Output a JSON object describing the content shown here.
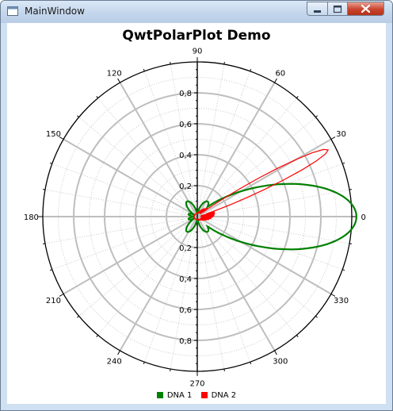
{
  "window": {
    "title": "MainWindow",
    "min_label": "–",
    "max_label": "□",
    "close_label": "✕"
  },
  "chart_data": {
    "type": "polar",
    "title": "QwtPolarPlot Demo",
    "angle_ticks": [
      "0",
      "30",
      "60",
      "90",
      "120",
      "150",
      "180",
      "210",
      "240",
      "270",
      "300",
      "330"
    ],
    "radius_ticks_up": [
      "0,2",
      "0,4",
      "0,6",
      "0,8"
    ],
    "radius_ticks_down": [
      "0,2",
      "0,4",
      "0,6",
      "0,8"
    ],
    "radius_range": [
      0,
      1
    ],
    "grid": true,
    "legend_position": "bottom",
    "series": [
      {
        "name": "DNA 1",
        "color": "#008000"
      },
      {
        "name": "DNA 2",
        "color": "#ff0000"
      }
    ]
  },
  "colors": {
    "dna1": "#008000",
    "dna2": "#ff0000",
    "grid_major": "#bebebe",
    "grid_minor": "#c8c8c8"
  }
}
